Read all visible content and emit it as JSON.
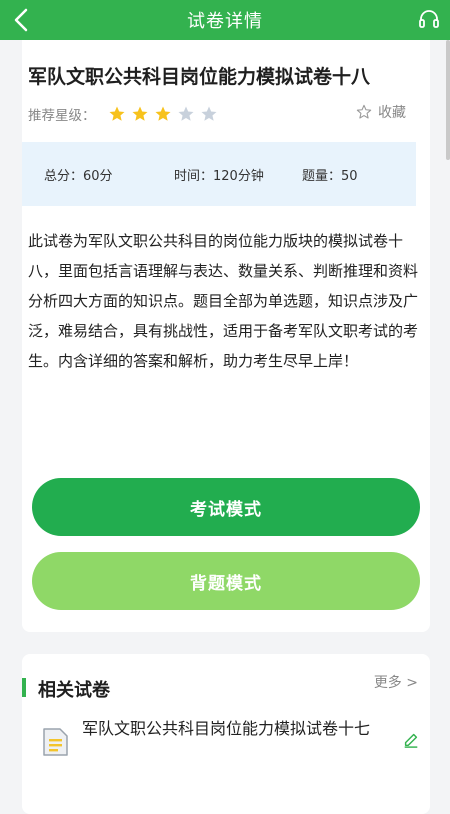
{
  "header": {
    "title": "试卷详情",
    "back_icon": "chevron-left-icon",
    "headset_icon": "headset-icon"
  },
  "exam": {
    "title": "军队文职公共科目岗位能力模拟试卷十八",
    "rating_label": "推荐星级：",
    "rating": 3,
    "rating_max": 5,
    "favorite_label": "收藏",
    "total_score": "总分：60分",
    "time": "时间：120分钟",
    "questions": "题量：50",
    "description": "此试卷为军队文职公共科目的岗位能力版块的模拟试卷十八，里面包括言语理解与表达、数量关系、判断推理和资料分析四大方面的知识点。题目全部为单选题，知识点涉及广泛，难易结合，具有挑战性，适用于备考军队文职考试的考生。内含详细的答案和解析，助力考生尽早上岸！"
  },
  "buttons": {
    "exam_mode": "考试模式",
    "recite_mode": "背题模式"
  },
  "related": {
    "title": "相关试卷",
    "more": "更多 >",
    "items": [
      {
        "title": "军队文职公共科目岗位能力模拟试卷十七"
      }
    ]
  },
  "colors": {
    "brand_green": "#33b24f",
    "exam_button": "#22ad4f",
    "recite_button": "#8fd867",
    "star_active": "#f7c21c",
    "star_inactive": "#c8d1dc",
    "info_bg": "#e8f3fc"
  }
}
